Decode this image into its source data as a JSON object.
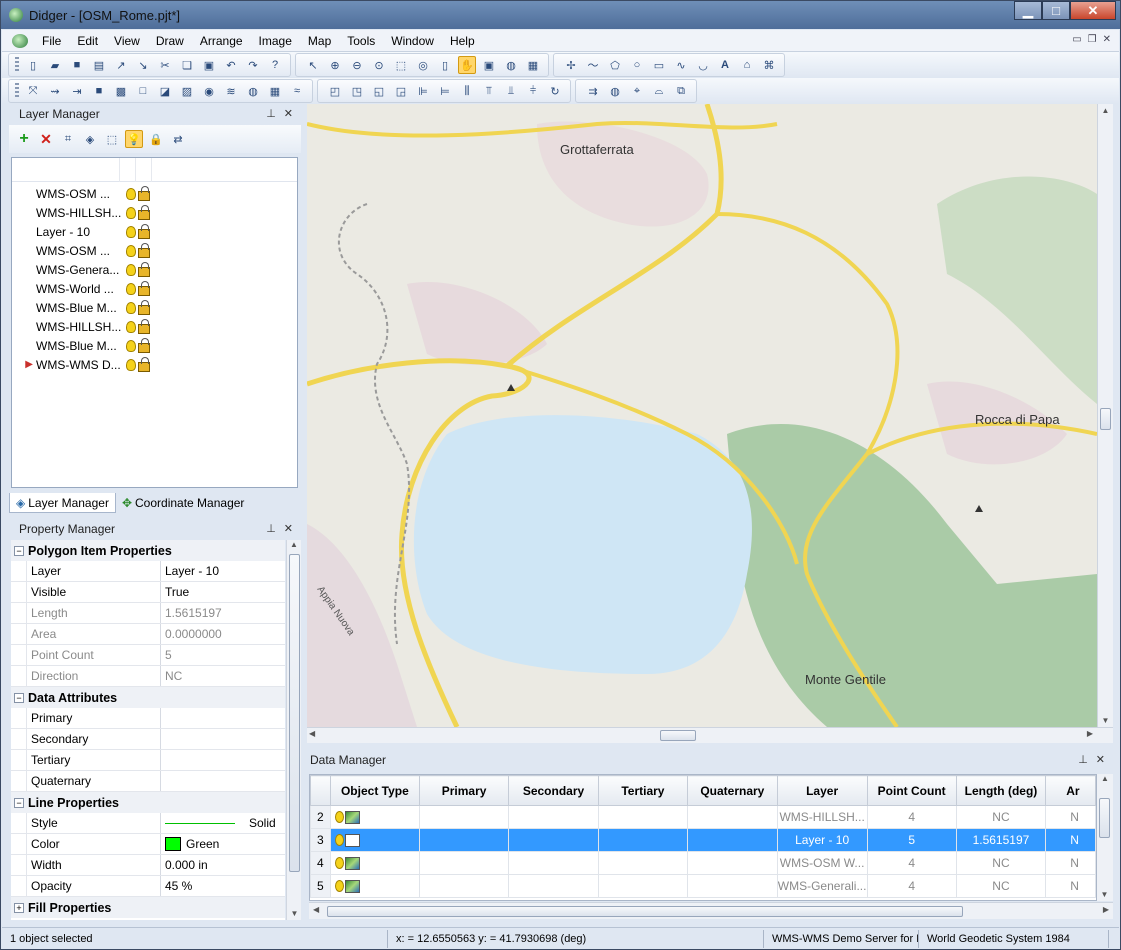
{
  "window": {
    "title": "Didger - [OSM_Rome.pjt*]",
    "min": "▁",
    "max": "□",
    "close": "✕"
  },
  "menu": [
    "File",
    "Edit",
    "View",
    "Draw",
    "Arrange",
    "Image",
    "Map",
    "Tools",
    "Window",
    "Help"
  ],
  "layer_manager": {
    "title": "Layer Manager",
    "layers": [
      {
        "name": "WMS-OSM ..."
      },
      {
        "name": "WMS-HILLSH..."
      },
      {
        "name": "Layer - 10"
      },
      {
        "name": "WMS-OSM ..."
      },
      {
        "name": "WMS-Genera..."
      },
      {
        "name": "WMS-World ..."
      },
      {
        "name": "WMS-Blue M..."
      },
      {
        "name": "WMS-HILLSH..."
      },
      {
        "name": "WMS-Blue M..."
      },
      {
        "name": "WMS-WMS D...",
        "current": true
      }
    ],
    "tabs": [
      "Layer Manager",
      "Coordinate Manager"
    ]
  },
  "property_manager": {
    "title": "Property Manager",
    "sections": [
      {
        "title": "Polygon Item Properties",
        "toggle": "−",
        "rows": [
          {
            "key": "Layer",
            "value": "Layer - 10"
          },
          {
            "key": "Visible",
            "value": "True"
          },
          {
            "key": "Length",
            "value": "1.5615197",
            "disabled": true
          },
          {
            "key": "Area",
            "value": "0.0000000",
            "disabled": true
          },
          {
            "key": "Point Count",
            "value": "5",
            "disabled": true
          },
          {
            "key": "Direction",
            "value": "NC",
            "disabled": true
          }
        ]
      },
      {
        "title": "Data Attributes",
        "toggle": "−",
        "rows": [
          {
            "key": "Primary",
            "value": ""
          },
          {
            "key": "Secondary",
            "value": ""
          },
          {
            "key": "Tertiary",
            "value": ""
          },
          {
            "key": "Quaternary",
            "value": ""
          }
        ]
      },
      {
        "title": "Line Properties",
        "toggle": "−",
        "rows": [
          {
            "key": "Style",
            "value": "Solid"
          },
          {
            "key": "Color",
            "value": "Green"
          },
          {
            "key": "Width",
            "value": "0.000 in"
          },
          {
            "key": "Opacity",
            "value": "45 %"
          }
        ]
      },
      {
        "title": "Fill Properties",
        "toggle": "+",
        "rows": []
      }
    ],
    "color_swatch": "#00ff00"
  },
  "map": {
    "labels": [
      "Grottaferrata",
      "Rocca di Papa",
      "Monte Gentile",
      "Appia Nuova"
    ]
  },
  "data_manager": {
    "title": "Data Manager",
    "columns": [
      "Object Type",
      "Primary",
      "Secondary",
      "Tertiary",
      "Quaternary",
      "Layer",
      "Point Count",
      "Length (deg)",
      "Ar"
    ],
    "rows": [
      {
        "n": "2",
        "layer": "WMS-HILLSH...",
        "points": "4",
        "length": "NC",
        "ar": "N",
        "kind": "image"
      },
      {
        "n": "3",
        "layer": "Layer - 10",
        "points": "5",
        "length": "1.5615197",
        "ar": "N",
        "kind": "polygon",
        "selected": true
      },
      {
        "n": "4",
        "layer": "WMS-OSM W...",
        "points": "4",
        "length": "NC",
        "ar": "N",
        "kind": "image"
      },
      {
        "n": "5",
        "layer": "WMS-Generali...",
        "points": "4",
        "length": "NC",
        "ar": "N",
        "kind": "image"
      }
    ]
  },
  "status": {
    "selection": "1 object selected",
    "coords": "x: = 12.6550563 y: = 41.7930698 (deg)",
    "layer": "WMS-WMS Demo Server for M",
    "system": "World Geodetic System 1984"
  },
  "colors": {
    "accent": "#3399ff",
    "water": "#cfe6f5",
    "forest": "#9cc49a",
    "road": "#f0d552"
  }
}
